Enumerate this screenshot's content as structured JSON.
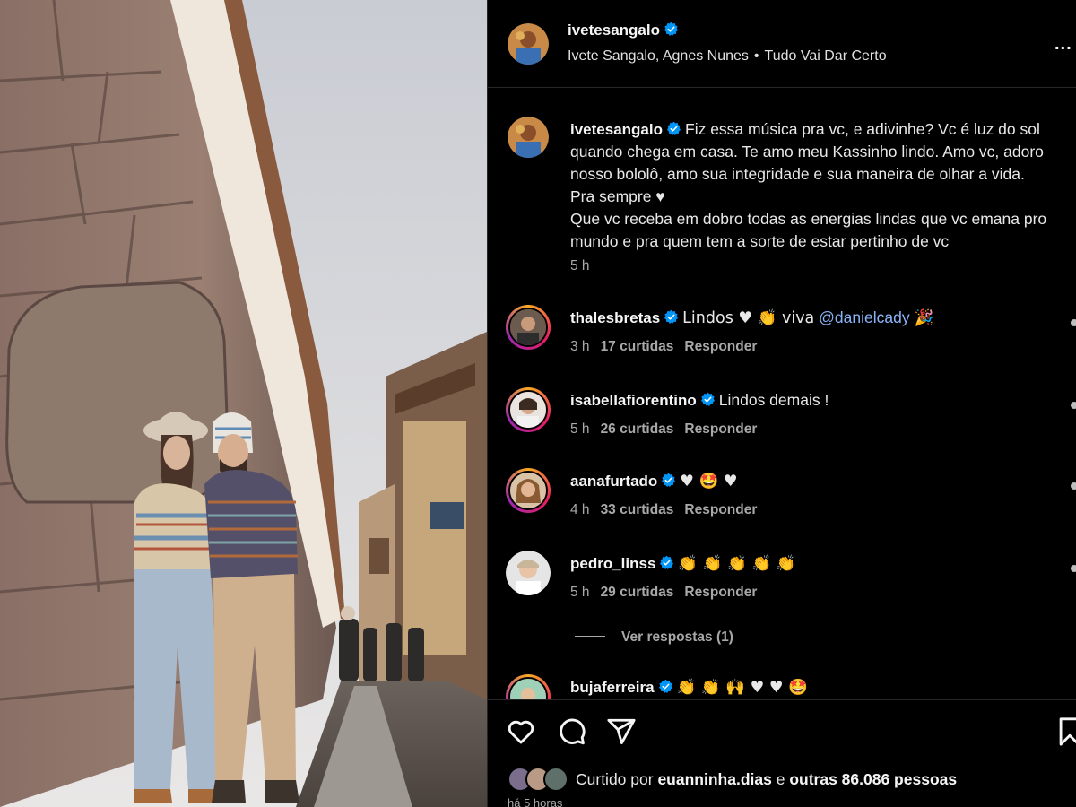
{
  "post": {
    "username": "ivetesangalo",
    "audio": {
      "artists": "Ivete Sangalo, Agnes Nunes",
      "separator": "•",
      "song": "Tudo Vai Dar Certo"
    },
    "more": "..."
  },
  "caption": {
    "username": "ivetesangalo",
    "text": "Fiz essa música pra vc, e adivinhe? Vc é luz do sol\nquando chega em casa. Te amo meu Kassinho lindo. Amo vc, adoro\nnosso bololô, amo sua integridade e sua maneira de olhar a vida.\nPra sempre ♥\nQue vc receba em dobro todas as energias lindas que vc emana pro\nmundo e pra quem tem a sorte de estar pertinho de vc",
    "time": "5 h"
  },
  "comments": [
    {
      "username": "thalesbretas",
      "text": "Lindos ♥ 👏 viva",
      "mention": "@danielcady",
      "tail": "🎉",
      "time": "3 h",
      "likes": "17 curtidas",
      "reply": "Responder"
    },
    {
      "username": "isabellafiorentino",
      "text": "Lindos demais !",
      "time": "5 h",
      "likes": "26 curtidas",
      "reply": "Responder"
    },
    {
      "username": "aanafurtado",
      "text": "♥ 🤩 ♥",
      "time": "4 h",
      "likes": "33 curtidas",
      "reply": "Responder"
    },
    {
      "username": "pedro_linss",
      "text": "👏 👏 👏 👏 👏",
      "time": "5 h",
      "likes": "29 curtidas",
      "reply": "Responder"
    },
    {
      "username": "bujaferreira",
      "text": "👏 👏 🙌 ♥ ♥ 🤩"
    }
  ],
  "view_replies": "Ver respostas (1)",
  "likes": {
    "prefix": "Curtido por",
    "user": "euanninha.dias",
    "joiner": "e",
    "others": "outras 86.086 pessoas"
  },
  "timestamp": "há 5 horas",
  "icons": [
    "heart-icon",
    "comment-icon",
    "share-icon",
    "bookmark-icon",
    "verified-icon",
    "more-icon"
  ],
  "colors": {
    "background": "#000000",
    "verified": "#0095f6",
    "mention": "#8ab4f8",
    "secondary_text": "#a8a8a8"
  }
}
